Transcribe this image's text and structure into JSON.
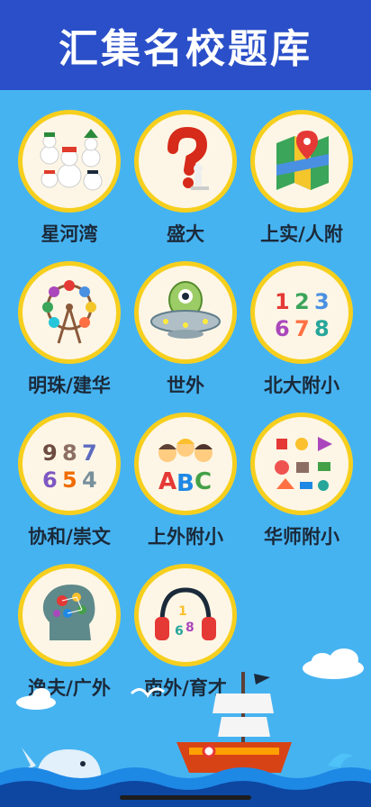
{
  "header": {
    "title": "汇集名校题库"
  },
  "tiles": [
    {
      "label": "星河湾",
      "icon": "snowmen-icon"
    },
    {
      "label": "盛大",
      "icon": "question-mark-icon"
    },
    {
      "label": "上实/人附",
      "icon": "map-icon"
    },
    {
      "label": "明珠/建华",
      "icon": "ferris-wheel-icon"
    },
    {
      "label": "世外",
      "icon": "ufo-alien-icon"
    },
    {
      "label": "北大附小",
      "icon": "numbers-123-icon"
    },
    {
      "label": "协和/崇文",
      "icon": "numbers-987-icon"
    },
    {
      "label": "上外附小",
      "icon": "kids-abc-icon"
    },
    {
      "label": "华师附小",
      "icon": "toys-icon"
    },
    {
      "label": "逸夫/广外",
      "icon": "brain-head-icon"
    },
    {
      "label": "南外/育才",
      "icon": "headphones-icon"
    }
  ],
  "colors": {
    "header": "#2a4fc8",
    "background": "#46b3f1",
    "ring": "#f6cf1e",
    "tile": "#fdf6e6"
  }
}
